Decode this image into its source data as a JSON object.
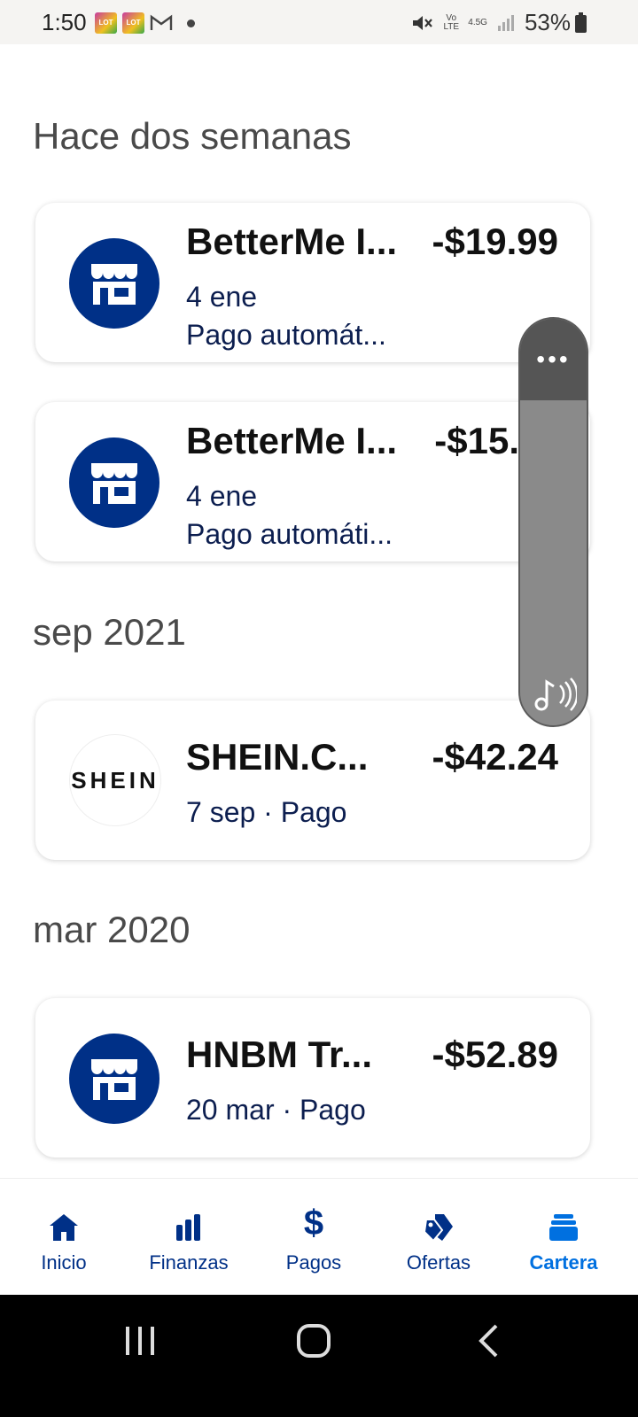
{
  "status_bar": {
    "time": "1:50",
    "battery": "53%",
    "network": "4.5G",
    "volte": "Vo LTE"
  },
  "sections": [
    {
      "title": "Hace dos semanas",
      "transactions": [
        {
          "merchant": "BetterMe I...",
          "amount": "-$19.99",
          "date": "4 ene",
          "detail": "Pago automát..."
        },
        {
          "merchant": "BetterMe I...",
          "amount": "-$15.",
          "date": "4 ene",
          "detail": "Pago automáti..."
        }
      ]
    },
    {
      "title": "sep 2021",
      "transactions": [
        {
          "merchant": "SHEIN.C...",
          "amount": "-$42.24",
          "date_detail": "7 sep · Pago",
          "logo_text": "SHEIN"
        }
      ]
    },
    {
      "title": "mar 2020",
      "transactions": [
        {
          "merchant": "HNBM  Tr...",
          "amount": "-$52.89",
          "date_detail": "20 mar · Pago"
        }
      ]
    }
  ],
  "floating_panel": {
    "menu_label": "•••"
  },
  "tabs": [
    {
      "label": "Inicio",
      "icon": "home-icon"
    },
    {
      "label": "Finanzas",
      "icon": "bar-chart-icon"
    },
    {
      "label": "Pagos",
      "icon": "dollar-icon"
    },
    {
      "label": "Ofertas",
      "icon": "tags-icon"
    },
    {
      "label": "Cartera",
      "icon": "wallet-icon",
      "active": true
    }
  ],
  "colors": {
    "brand": "#003087",
    "active": "#0070e0"
  }
}
